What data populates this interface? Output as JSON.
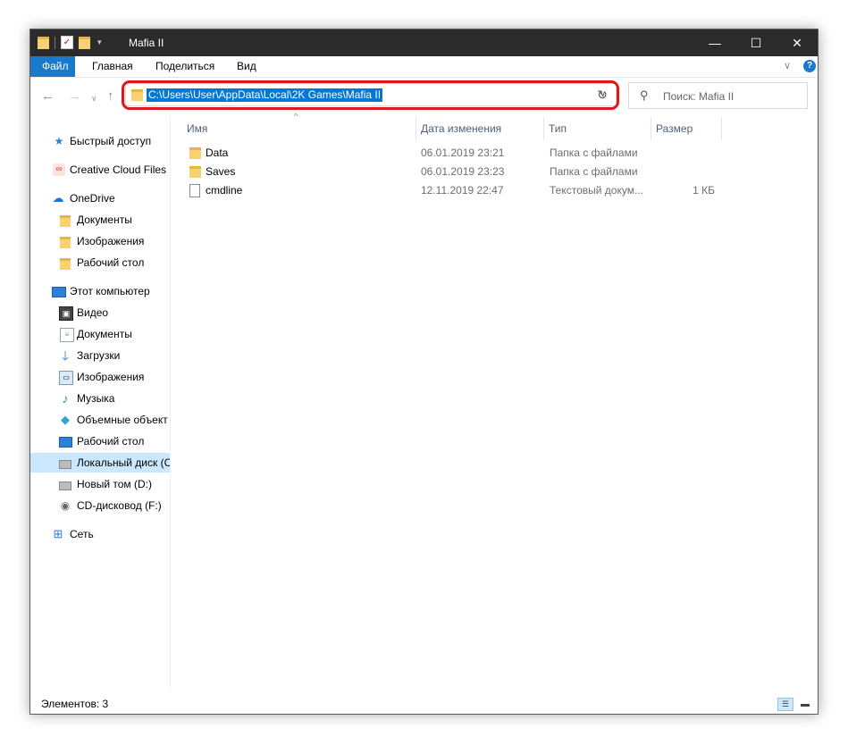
{
  "window": {
    "title": "Mafia II"
  },
  "titlebar": {
    "min_icon": "minimize-icon",
    "max_icon": "maximize-icon",
    "close_icon": "close-icon"
  },
  "ribbon": {
    "tabs": [
      {
        "label": "Файл"
      },
      {
        "label": "Главная"
      },
      {
        "label": "Поделиться"
      },
      {
        "label": "Вид"
      }
    ],
    "help_label": "?"
  },
  "address": {
    "path": "C:\\Users\\User\\AppData\\Local\\2K Games\\Mafia II",
    "highlight_color": "#e0161d",
    "selection_color": "#0078d7"
  },
  "search": {
    "placeholder": "Поиск: Mafia II"
  },
  "sidebar": {
    "items": [
      {
        "label": "Быстрый доступ",
        "icon": "star-icon"
      },
      {
        "label": "Creative Cloud Files",
        "icon": "creative-cloud-icon"
      },
      {
        "label": "OneDrive",
        "icon": "cloud-icon"
      },
      {
        "label": "Документы",
        "icon": "folder-icon"
      },
      {
        "label": "Изображения",
        "icon": "folder-icon"
      },
      {
        "label": "Рабочий стол",
        "icon": "folder-icon"
      },
      {
        "label": "Этот компьютер",
        "icon": "computer-icon"
      },
      {
        "label": "Видео",
        "icon": "video-icon"
      },
      {
        "label": "Документы",
        "icon": "documents-icon"
      },
      {
        "label": "Загрузки",
        "icon": "download-icon"
      },
      {
        "label": "Изображения",
        "icon": "pictures-icon"
      },
      {
        "label": "Музыка",
        "icon": "music-icon"
      },
      {
        "label": "Объемные объект",
        "icon": "3d-objects-icon"
      },
      {
        "label": "Рабочий стол",
        "icon": "desktop-icon"
      },
      {
        "label": "Локальный диск (C",
        "icon": "drive-icon"
      },
      {
        "label": "Новый том (D:)",
        "icon": "drive-icon"
      },
      {
        "label": "CD-дисковод (F:)",
        "icon": "cd-drive-icon"
      },
      {
        "label": "Сеть",
        "icon": "network-icon"
      }
    ]
  },
  "files": {
    "columns": [
      "Имя",
      "Дата изменения",
      "Тип",
      "Размер"
    ],
    "rows": [
      {
        "name": "Data",
        "date": "06.01.2019 23:21",
        "type": "Папка с файлами",
        "size": "",
        "icon": "folder-icon"
      },
      {
        "name": "Saves",
        "date": "06.01.2019 23:23",
        "type": "Папка с файлами",
        "size": "",
        "icon": "folder-icon"
      },
      {
        "name": "cmdline",
        "date": "12.11.2019 22:47",
        "type": "Текстовый докум...",
        "size": "1 КБ",
        "icon": "text-file-icon"
      }
    ]
  },
  "status": {
    "text": "Элементов: 3"
  }
}
